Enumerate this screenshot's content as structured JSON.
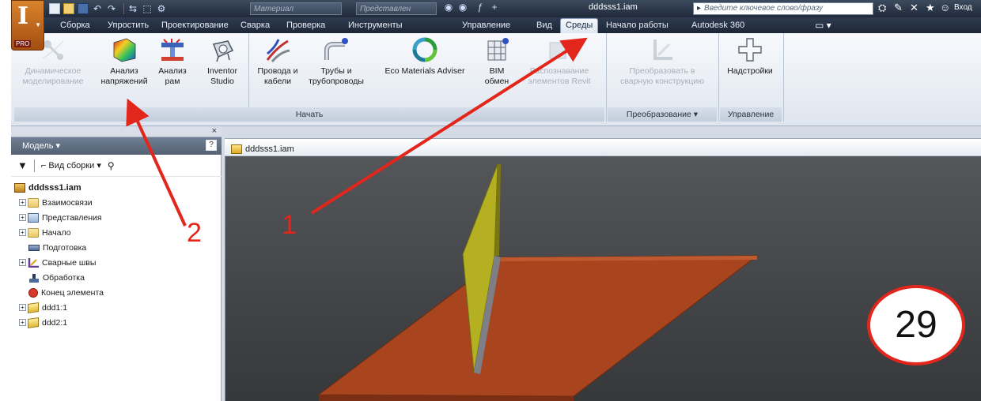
{
  "title_bar": {
    "app_letter": "I",
    "app_badge": "PRO",
    "material_placeholder": "Материал",
    "representation_placeholder": "Представлен",
    "doc_title": "dddsss1.iam",
    "search_placeholder": "Введите ключевое слово/фразу",
    "login_label": "Вход"
  },
  "tabs": [
    {
      "label": "Сборка"
    },
    {
      "label": "Упростить"
    },
    {
      "label": "Проектирование"
    },
    {
      "label": "Сварка"
    },
    {
      "label": "Проверка"
    },
    {
      "label": "Инструменты"
    },
    {
      "label": "Управление"
    },
    {
      "label": "Вид"
    },
    {
      "label": "Среды",
      "active": true
    },
    {
      "label": "Начало работы"
    },
    {
      "label": "Autodesk 360"
    }
  ],
  "ribbon": {
    "buttons": [
      {
        "line1": "Динамическое",
        "line2": "моделирование",
        "disabled": true,
        "icon": "dynamic-simulation-icon"
      },
      {
        "line1": "Анализ",
        "line2": "напряжений",
        "disabled": false,
        "icon": "stress-analysis-icon"
      },
      {
        "line1": "Анализ",
        "line2": "рам",
        "disabled": false,
        "icon": "frame-analysis-icon"
      },
      {
        "line1": "Inventor",
        "line2": "Studio",
        "disabled": false,
        "icon": "inventor-studio-icon"
      },
      {
        "line1": "Провода и",
        "line2": "кабели",
        "disabled": false,
        "icon": "cable-harness-icon"
      },
      {
        "line1": "Трубы и",
        "line2": "трубопроводы",
        "disabled": false,
        "icon": "tube-pipe-icon"
      },
      {
        "line1": "Eco Materials Adviser",
        "line2": "",
        "disabled": false,
        "icon": "eco-materials-icon"
      },
      {
        "line1": "BIM",
        "line2": "обмен",
        "disabled": false,
        "icon": "bim-exchange-icon"
      },
      {
        "line1": "Распознавание",
        "line2": "элементов Revit",
        "disabled": true,
        "icon": "revit-recognition-icon"
      },
      {
        "line1": "Преобразовать в",
        "line2": "сварную конструкцию",
        "disabled": true,
        "icon": "convert-weldment-icon"
      },
      {
        "line1": "Надстройки",
        "line2": "",
        "disabled": false,
        "icon": "addins-icon"
      }
    ],
    "panels": [
      {
        "label": "Начать"
      },
      {
        "label": "Преобразование ▾"
      },
      {
        "label": "Управление"
      }
    ]
  },
  "browser": {
    "header": "Модель ▾",
    "help": "?",
    "close": "×",
    "view_label": "Вид сборки",
    "tree": [
      {
        "label": "dddsss1.iam",
        "icon": "assembly-icon",
        "root": true
      },
      {
        "label": "Взаимосвязи",
        "icon": "folder-icon",
        "expandable": true
      },
      {
        "label": "Представления",
        "icon": "representations-icon",
        "expandable": true
      },
      {
        "label": "Начало",
        "icon": "folder-icon",
        "expandable": true
      },
      {
        "label": "Подготовка",
        "icon": "preparation-icon",
        "expandable": false
      },
      {
        "label": "Сварные швы",
        "icon": "welds-icon",
        "expandable": true
      },
      {
        "label": "Обработка",
        "icon": "machining-icon",
        "expandable": false
      },
      {
        "label": "Конец элемента",
        "icon": "end-of-features-icon",
        "expandable": false
      },
      {
        "label": "ddd1:1",
        "icon": "part-icon",
        "expandable": true
      },
      {
        "label": "ddd2:1",
        "icon": "part-icon",
        "expandable": true
      }
    ]
  },
  "viewport": {
    "tab_label": "dddsss1.iam",
    "colors": {
      "plate": "#a8451f",
      "fin": "#b5b022",
      "background": "#45474a"
    }
  },
  "annotations": {
    "callout_1": "1",
    "callout_2": "2",
    "page_badge": "29",
    "color": "#e2261c"
  }
}
